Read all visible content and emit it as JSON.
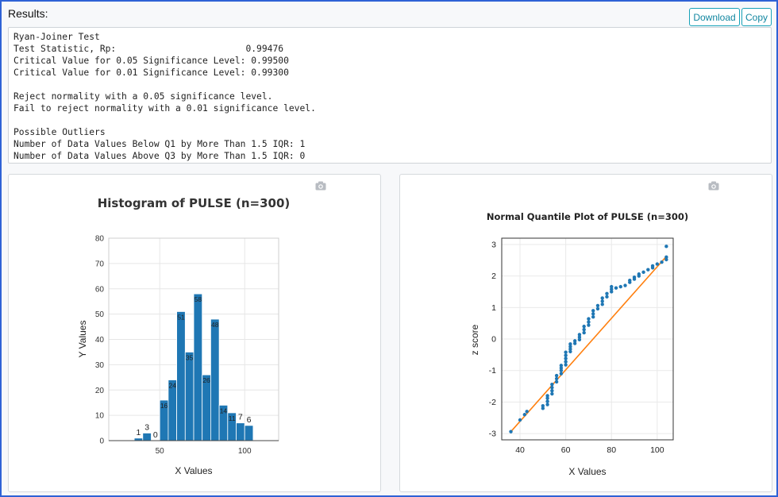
{
  "header": {
    "results_label": "Results:",
    "download_label": "Download",
    "copy_label": "Copy"
  },
  "output_lines": [
    "Ryan-Joiner Test",
    "Test Statistic, Rp:                        0.99476",
    "Critical Value for 0.05 Significance Level: 0.99500",
    "Critical Value for 0.01 Significance Level: 0.99300",
    "",
    "Reject normality with a 0.05 significance level.",
    "Fail to reject normality with a 0.01 significance level.",
    "",
    "Possible Outliers",
    "Number of Data Values Below Q1 by More Than 1.5 IQR: 1",
    "Number of Data Values Above Q3 by More Than 1.5 IQR: 0"
  ],
  "icons": {
    "snapshot": "camera-icon"
  },
  "colors": {
    "bar": "#1f77b4",
    "point": "#1f77b4",
    "fit_line": "#ff7f0e",
    "accent": "#17a2b8"
  },
  "chart_data": [
    {
      "type": "bar",
      "title": "Histogram of PULSE (n=300)",
      "xlabel": "X Values",
      "ylabel": "Y Values",
      "bin_width": 5,
      "bins": [
        {
          "start": 35,
          "end": 40,
          "count": 1
        },
        {
          "start": 40,
          "end": 45,
          "count": 3
        },
        {
          "start": 45,
          "end": 50,
          "count": 0
        },
        {
          "start": 50,
          "end": 55,
          "count": 16
        },
        {
          "start": 55,
          "end": 60,
          "count": 24
        },
        {
          "start": 60,
          "end": 65,
          "count": 51
        },
        {
          "start": 65,
          "end": 70,
          "count": 35
        },
        {
          "start": 70,
          "end": 75,
          "count": 58
        },
        {
          "start": 75,
          "end": 80,
          "count": 26
        },
        {
          "start": 80,
          "end": 85,
          "count": 48
        },
        {
          "start": 85,
          "end": 90,
          "count": 14
        },
        {
          "start": 90,
          "end": 95,
          "count": 11
        },
        {
          "start": 95,
          "end": 100,
          "count": 7
        },
        {
          "start": 100,
          "end": 105,
          "count": 6
        }
      ],
      "xlim": [
        20,
        120
      ],
      "ylim": [
        0,
        80
      ],
      "x_ticks": [
        50,
        100
      ],
      "y_ticks": [
        0,
        10,
        20,
        30,
        40,
        50,
        60,
        70,
        80
      ],
      "grid": true,
      "data_labels": true
    },
    {
      "type": "scatter",
      "title": "Normal Quantile Plot of PULSE (n=300)",
      "xlabel": "X Values",
      "ylabel": "z score",
      "xlim": [
        32,
        107
      ],
      "ylim": [
        -3.2,
        3.2
      ],
      "x_ticks": [
        40,
        60,
        80,
        100
      ],
      "y_ticks": [
        -3,
        -2,
        -1,
        0,
        1,
        2,
        3
      ],
      "grid": true,
      "points": [
        [
          36,
          -2.94
        ],
        [
          40,
          -2.57
        ],
        [
          42,
          -2.4
        ],
        [
          43,
          -2.3
        ],
        [
          50,
          -2.2
        ],
        [
          50,
          -2.12
        ],
        [
          52,
          -2.08
        ],
        [
          52,
          -1.98
        ],
        [
          52,
          -1.88
        ],
        [
          52,
          -1.8
        ],
        [
          54,
          -1.74
        ],
        [
          54,
          -1.64
        ],
        [
          54,
          -1.54
        ],
        [
          54,
          -1.44
        ],
        [
          56,
          -1.36
        ],
        [
          56,
          -1.26
        ],
        [
          56,
          -1.16
        ],
        [
          58,
          -1.1
        ],
        [
          58,
          -1.0
        ],
        [
          58,
          -0.92
        ],
        [
          58,
          -0.84
        ],
        [
          60,
          -0.82
        ],
        [
          60,
          -0.72
        ],
        [
          60,
          -0.62
        ],
        [
          60,
          -0.52
        ],
        [
          60,
          -0.42
        ],
        [
          62,
          -0.4
        ],
        [
          62,
          -0.32
        ],
        [
          62,
          -0.24
        ],
        [
          62,
          -0.16
        ],
        [
          64,
          -0.14
        ],
        [
          64,
          -0.06
        ],
        [
          66,
          -0.02
        ],
        [
          66,
          0.06
        ],
        [
          66,
          0.14
        ],
        [
          68,
          0.2
        ],
        [
          68,
          0.3
        ],
        [
          68,
          0.4
        ],
        [
          70,
          0.44
        ],
        [
          70,
          0.54
        ],
        [
          70,
          0.64
        ],
        [
          72,
          0.7
        ],
        [
          72,
          0.8
        ],
        [
          72,
          0.9
        ],
        [
          74,
          0.96
        ],
        [
          74,
          1.06
        ],
        [
          76,
          1.1
        ],
        [
          76,
          1.2
        ],
        [
          76,
          1.3
        ],
        [
          78,
          1.34
        ],
        [
          78,
          1.44
        ],
        [
          80,
          1.5
        ],
        [
          80,
          1.58
        ],
        [
          80,
          1.66
        ],
        [
          82,
          1.62
        ],
        [
          84,
          1.66
        ],
        [
          86,
          1.7
        ],
        [
          88,
          1.8
        ],
        [
          88,
          1.86
        ],
        [
          90,
          1.9
        ],
        [
          90,
          1.96
        ],
        [
          92,
          2.0
        ],
        [
          92,
          2.06
        ],
        [
          94,
          2.12
        ],
        [
          96,
          2.2
        ],
        [
          98,
          2.26
        ],
        [
          98,
          2.32
        ],
        [
          100,
          2.38
        ],
        [
          102,
          2.44
        ],
        [
          104,
          2.52
        ],
        [
          104,
          2.6
        ],
        [
          104,
          2.94
        ]
      ],
      "fit_line": [
        [
          36,
          -2.94
        ],
        [
          104,
          2.62
        ]
      ]
    }
  ]
}
